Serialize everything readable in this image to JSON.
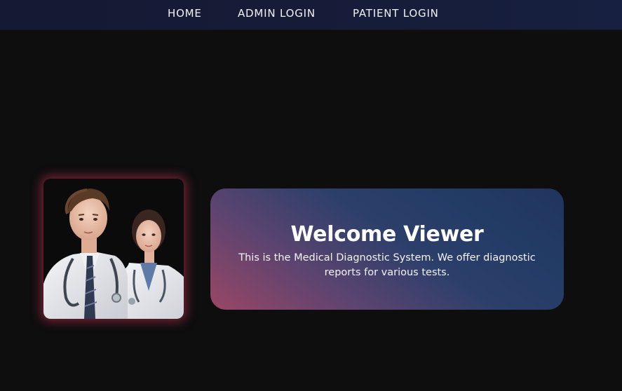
{
  "nav": {
    "items": [
      {
        "label": "HOME"
      },
      {
        "label": "ADMIN LOGIN"
      },
      {
        "label": "PATIENT LOGIN"
      }
    ]
  },
  "hero": {
    "image_icon": "doctors-illustration"
  },
  "welcome": {
    "title": "Welcome Viewer",
    "description": "This is the Medical Diagnostic System. We offer diagnostic reports for various tests."
  },
  "colors": {
    "background": "#0e0e0f",
    "navbar": "#161c38",
    "image_glow": "#c83250",
    "card_gradient_start": "#9a4665",
    "card_gradient_end": "#20355f"
  }
}
